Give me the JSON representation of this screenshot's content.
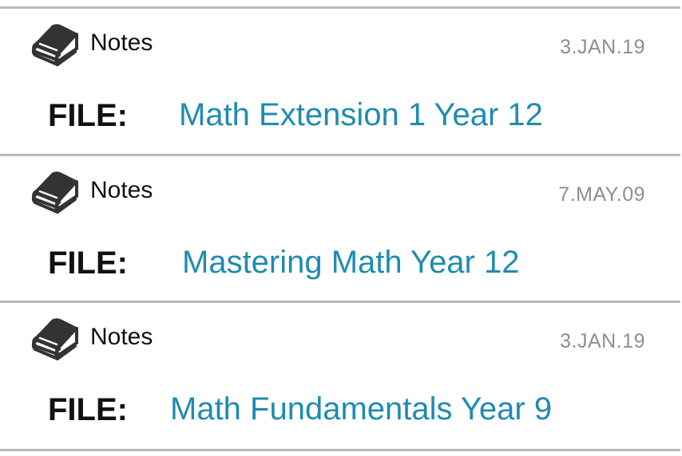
{
  "entries": [
    {
      "icon": "book-stack-icon",
      "category": "Notes",
      "date": "3.JAN.19",
      "file_label": "FILE:",
      "file_name": "Math Extension 1 Year 12"
    },
    {
      "icon": "book-stack-icon",
      "category": "Notes",
      "date": "7.MAY.09",
      "file_label": "FILE:",
      "file_name": "Mastering Math Year 12"
    },
    {
      "icon": "book-stack-icon",
      "category": "Notes",
      "date": "3.JAN.19",
      "file_label": "FILE:",
      "file_name": "Math Fundamentals Year 9"
    }
  ],
  "colors": {
    "link": "#1f8bb0",
    "date": "#8e8e8e",
    "divider": "#b9b9b9",
    "text": "#111111"
  }
}
